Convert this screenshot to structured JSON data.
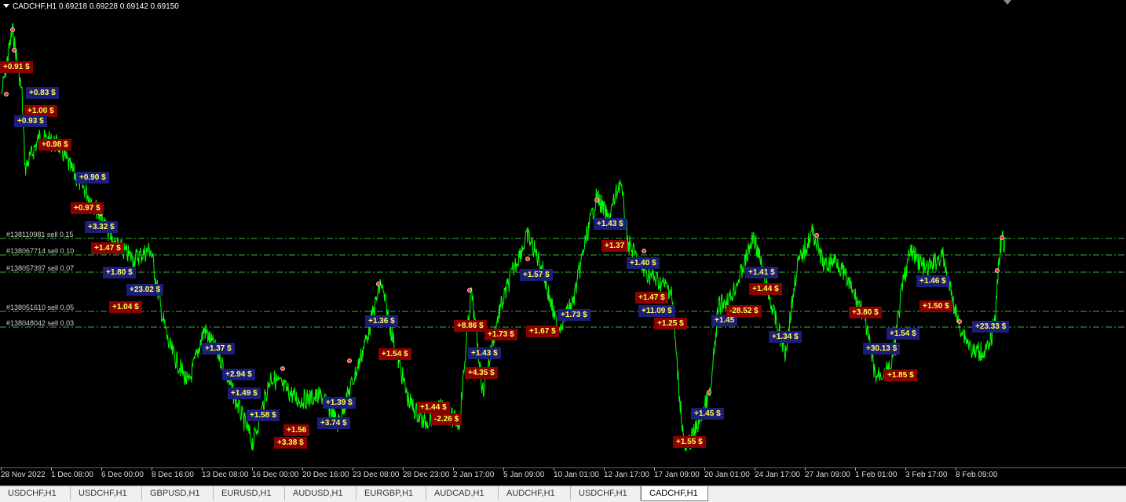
{
  "header": {
    "title": "CADCHF,H1  0.69218 0.69228 0.69142 0.69150"
  },
  "colors": {
    "price": "#00ff00",
    "buy_bg": "#1c1e7a",
    "sell_bg": "#8b0000",
    "tag_text": "#ffff55",
    "order_line": "#3cb043"
  },
  "order_lines": [
    {
      "label": "#138110981 sell 0.15"
    },
    {
      "label": "#138067714 sell 0.10"
    },
    {
      "label": "#138057397 sell 0.07"
    },
    {
      "label": "#138051610 sell 0.05"
    },
    {
      "label": "#138048042 sell 0.03"
    }
  ],
  "tags": [
    {
      "text": "+0.91 $",
      "kind": "sell"
    },
    {
      "text": "+0.83 $",
      "kind": "buy"
    },
    {
      "text": "+1.00 $",
      "kind": "sell"
    },
    {
      "text": "+0.93 $",
      "kind": "buy"
    },
    {
      "text": "+0.98 $",
      "kind": "sell"
    },
    {
      "text": "+0.90 $",
      "kind": "buy"
    },
    {
      "text": "+0.97 $",
      "kind": "sell"
    },
    {
      "text": "+3.32 $",
      "kind": "buy"
    },
    {
      "text": "+1.47 $",
      "kind": "sell"
    },
    {
      "text": "+1.80 $",
      "kind": "buy"
    },
    {
      "text": "+23.02 $",
      "kind": "buy"
    },
    {
      "text": "+1.04 $",
      "kind": "sell"
    },
    {
      "text": "+1.37 $",
      "kind": "buy"
    },
    {
      "text": "+2.94 $",
      "kind": "buy"
    },
    {
      "text": "+1.49 $",
      "kind": "buy"
    },
    {
      "text": "+1.58 $",
      "kind": "buy"
    },
    {
      "text": "+1.56",
      "kind": "sell"
    },
    {
      "text": "+3.38 $",
      "kind": "sell"
    },
    {
      "text": "+1.39 $",
      "kind": "buy"
    },
    {
      "text": "+3.74 $",
      "kind": "buy"
    },
    {
      "text": "+1.36 $",
      "kind": "buy"
    },
    {
      "text": "+1.54 $",
      "kind": "sell"
    },
    {
      "text": "+8.86 $",
      "kind": "sell"
    },
    {
      "text": "+1.73 $",
      "kind": "sell"
    },
    {
      "text": "+1.43 $",
      "kind": "buy"
    },
    {
      "text": "+4.35 $",
      "kind": "sell"
    },
    {
      "text": "+1.44 $",
      "kind": "sell"
    },
    {
      "text": "-2.26 $",
      "kind": "sell"
    },
    {
      "text": "+1.57 $",
      "kind": "buy"
    },
    {
      "text": "+1.67 $",
      "kind": "sell"
    },
    {
      "text": "+1.73 $",
      "kind": "buy"
    },
    {
      "text": "+1.43 $",
      "kind": "buy"
    },
    {
      "text": "+1.37",
      "kind": "sell"
    },
    {
      "text": "+1.40 $",
      "kind": "buy"
    },
    {
      "text": "+1.47 $",
      "kind": "sell"
    },
    {
      "text": "+11.09 $",
      "kind": "buy"
    },
    {
      "text": "+1.25 $",
      "kind": "sell"
    },
    {
      "text": "+1.45 $",
      "kind": "buy"
    },
    {
      "text": "+1.55 $",
      "kind": "sell"
    },
    {
      "text": "+1.45",
      "kind": "buy"
    },
    {
      "text": "-28.52 $",
      "kind": "sell"
    },
    {
      "text": "+1.44 $",
      "kind": "sell"
    },
    {
      "text": "+1.34 $",
      "kind": "buy"
    },
    {
      "text": "+1.41 $",
      "kind": "buy"
    },
    {
      "text": "+3.80 $",
      "kind": "sell"
    },
    {
      "text": "+30.13 $",
      "kind": "buy"
    },
    {
      "text": "+1.54 $",
      "kind": "buy"
    },
    {
      "text": "+1.85 $",
      "kind": "sell"
    },
    {
      "text": "+1.46 $",
      "kind": "buy"
    },
    {
      "text": "+1.50 $",
      "kind": "sell"
    },
    {
      "text": "+23.33 $",
      "kind": "buy"
    }
  ],
  "time_axis": [
    "28 Nov 2022",
    "1 Dec 08:00",
    "6 Dec 00:00",
    "8 Dec 16:00",
    "13 Dec 08:00",
    "16 Dec 00:00",
    "20 Dec 16:00",
    "23 Dec 08:00",
    "28 Dec 23:00",
    "2 Jan 17:00",
    "5 Jan 09:00",
    "10 Jan 01:00",
    "12 Jan 17:00",
    "17 Jan 09:00",
    "20 Jan 01:00",
    "24 Jan 17:00",
    "27 Jan 09:00",
    "1 Feb 01:00",
    "3 Feb 17:00",
    "8 Feb 09:00"
  ],
  "tabs": [
    {
      "label": "USDCHF,H1",
      "active": false
    },
    {
      "label": "USDCHF,H1",
      "active": false
    },
    {
      "label": "GBPUSD,H1",
      "active": false
    },
    {
      "label": "EURUSD,H1",
      "active": false
    },
    {
      "label": "AUDUSD,H1",
      "active": false
    },
    {
      "label": "EURGBP,H1",
      "active": false
    },
    {
      "label": "AUDCAD,H1",
      "active": false
    },
    {
      "label": "AUDCHF,H1",
      "active": false
    },
    {
      "label": "USDCHF,H1",
      "active": false
    },
    {
      "label": "CADCHF,H1",
      "active": true
    }
  ]
}
